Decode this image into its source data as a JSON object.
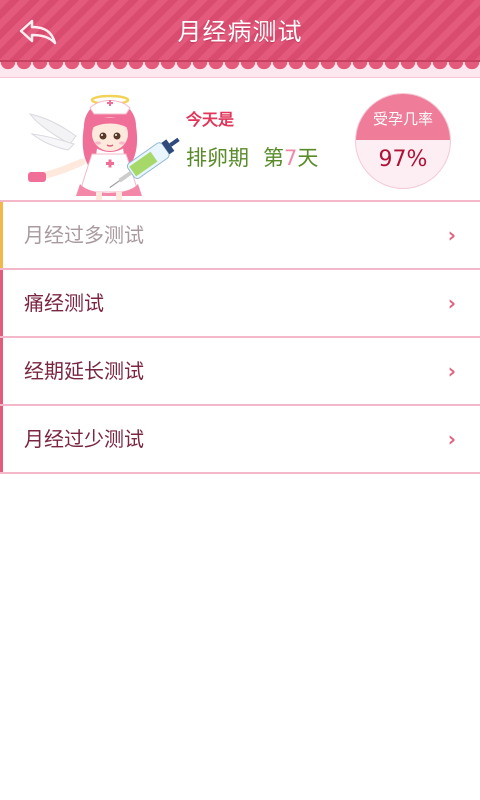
{
  "header": {
    "title": "月经病测试",
    "back_icon": "back-arrow-icon"
  },
  "status": {
    "today_label": "今天是",
    "phase": "排卵期",
    "day_prefix": "第",
    "day_number": "7",
    "day_suffix": "天",
    "pregnancy_rate_label": "受孕几率",
    "pregnancy_rate_value": "97%"
  },
  "tests": {
    "items": [
      {
        "label": "月经过多测试",
        "selected": true
      },
      {
        "label": "痛经测试",
        "selected": false
      },
      {
        "label": "经期延长测试",
        "selected": false
      },
      {
        "label": "月经过少测试",
        "selected": false
      }
    ],
    "chevron": "›"
  },
  "colors": {
    "header": "#e35a7c",
    "accent_pink": "#e35a7c",
    "phase_green": "#5a8b2a",
    "rate_red": "#b01236",
    "selected_marker": "#f3b74a"
  }
}
